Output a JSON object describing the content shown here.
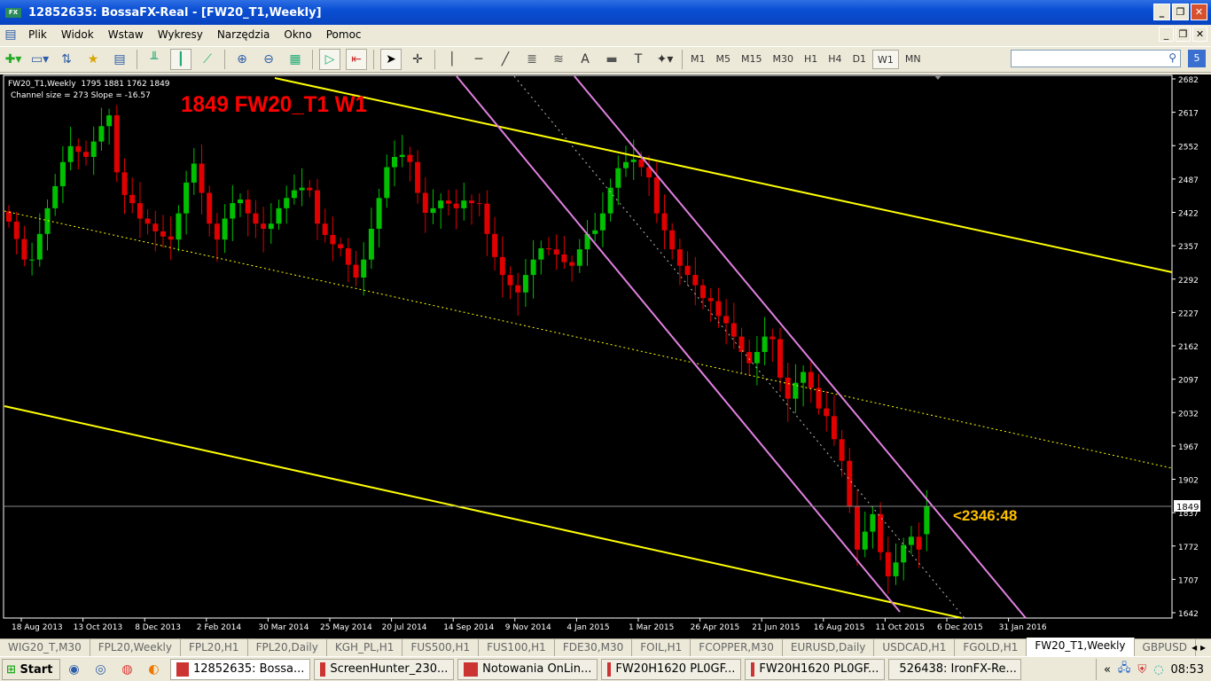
{
  "window": {
    "title": "12852635: BossaFX-Real - [FW20_T1,Weekly]",
    "logo": "FX"
  },
  "menu": [
    "Plik",
    "Widok",
    "Wstaw",
    "Wykresy",
    "Narzędzia",
    "Okno",
    "Pomoc"
  ],
  "timeframes": [
    "M1",
    "M5",
    "M15",
    "M30",
    "H1",
    "H4",
    "D1",
    "W1",
    "MN"
  ],
  "active_timeframe": "W1",
  "help_label": "5",
  "chart": {
    "info_line": "FW20_T1,Weekly  1795 1881 1762 1849",
    "channel_line": "Channel size = 273 Slope = -16.57",
    "big_label": "1849 FW20_T1 W1",
    "annotation": "<2346:48",
    "current_price": "1849",
    "colors": {
      "bull": "#00c000",
      "bear": "#e00000",
      "channel": "#ffff00",
      "trend": "#e080e0",
      "label": "#ff0000",
      "annotation": "#ffc000"
    }
  },
  "chart_data": {
    "type": "candlestick",
    "symbol": "FW20_T1",
    "period": "Weekly",
    "ylim": [
      1642,
      2682
    ],
    "y_ticks": [
      "2682",
      "2617",
      "2552",
      "2487",
      "2422",
      "2357",
      "2292",
      "2227",
      "2162",
      "2097",
      "2032",
      "1967",
      "1902",
      "1837",
      "1772",
      "1707",
      "1642"
    ],
    "x_ticks": [
      "18 Aug 2013",
      "13 Oct 2013",
      "8 Dec 2013",
      "2 Feb 2014",
      "30 Mar 2014",
      "25 May 2014",
      "20 Jul 2014",
      "14 Sep 2014",
      "9 Nov 2014",
      "4 Jan 2015",
      "1 Mar 2015",
      "26 Apr 2015",
      "21 Jun 2015",
      "16 Aug 2015",
      "11 Oct 2015",
      "6 Dec 2015",
      "31 Jan 2016"
    ],
    "last_bar": {
      "open": 1795,
      "high": 1881,
      "low": 1762,
      "close": 1849
    },
    "closes": [
      2404,
      2370,
      2330,
      2330,
      2380,
      2430,
      2473,
      2520,
      2551,
      2540,
      2530,
      2560,
      2590,
      2611,
      2500,
      2456,
      2440,
      2410,
      2400,
      2385,
      2375,
      2369,
      2420,
      2480,
      2517,
      2460,
      2400,
      2369,
      2410,
      2440,
      2447,
      2420,
      2400,
      2390,
      2400,
      2430,
      2450,
      2465,
      2470,
      2465,
      2400,
      2378,
      2360,
      2352,
      2320,
      2295,
      2330,
      2390,
      2450,
      2510,
      2530,
      2534,
      2520,
      2460,
      2421,
      2430,
      2445,
      2439,
      2430,
      2445,
      2440,
      2439,
      2380,
      2335,
      2300,
      2280,
      2266,
      2300,
      2330,
      2352,
      2350,
      2340,
      2325,
      2318,
      2350,
      2380,
      2387,
      2420,
      2470,
      2508,
      2520,
      2525,
      2510,
      2490,
      2420,
      2387,
      2350,
      2318,
      2300,
      2280,
      2255,
      2249,
      2220,
      2206,
      2180,
      2150,
      2128,
      2150,
      2180,
      2175,
      2100,
      2059,
      2090,
      2111,
      2080,
      2040,
      2025,
      1980,
      1938,
      1850,
      1765,
      1800,
      1834,
      1760,
      1713,
      1740,
      1774,
      1790,
      1765,
      1849
    ]
  },
  "tabs": [
    "WIG20_T,M30",
    "FPL20,Weekly",
    "FPL20,H1",
    "FPL20,Daily",
    "KGH_PL,H1",
    "FUS500,H1",
    "FUS100,H1",
    "FDE30,M30",
    "FOIL,H1",
    "FCOPPER,M30",
    "EURUSD,Daily",
    "USDCAD,H1",
    "FGOLD,H1",
    "FW20_T1,Weekly",
    "GBPUSD"
  ],
  "active_tab": "FW20_T1,Weekly",
  "taskbar": {
    "start": "Start",
    "tasks": [
      "12852635: Bossa...",
      "ScreenHunter_230...",
      "Notowania OnLin...",
      "FW20H1620 PL0GF...",
      "FW20H1620 PL0GF...",
      "526438: IronFX-Re..."
    ],
    "clock": "08:53"
  }
}
